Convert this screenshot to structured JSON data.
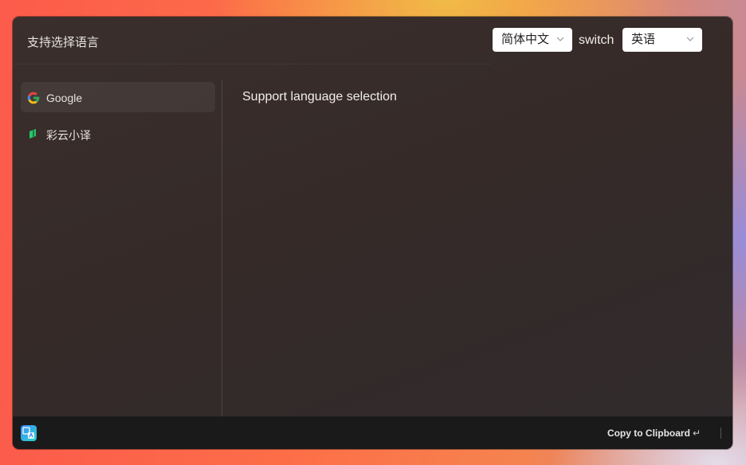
{
  "header": {
    "title": "支持选择语言",
    "source_language": "简体中文",
    "switch_label": "switch",
    "target_language": "英语"
  },
  "sidebar": {
    "items": [
      {
        "label": "Google",
        "icon": "google-icon",
        "active": true
      },
      {
        "label": "彩云小译",
        "icon": "caiyun-icon",
        "active": false
      }
    ]
  },
  "result": {
    "text": "Support language selection"
  },
  "footer": {
    "app_icon": "translate-app-icon",
    "copy_label": "Copy to Clipboard",
    "enter_glyph": "↵"
  },
  "colors": {
    "google_blue": "#4285F4",
    "google_red": "#EA4335",
    "google_yellow": "#FBBC05",
    "google_green": "#34A853",
    "caiyun_green": "#2bc46a"
  }
}
